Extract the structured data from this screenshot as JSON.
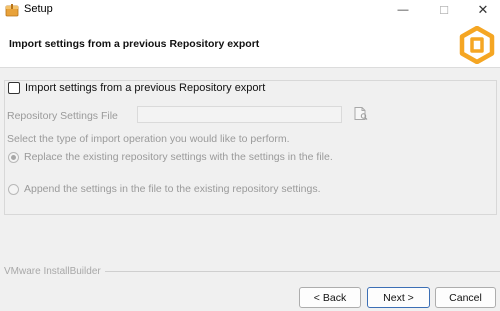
{
  "window": {
    "title": "Setup",
    "icon": "setup-app-icon",
    "controls": {
      "minimize": "—",
      "maximize": "☐",
      "close": "✕"
    }
  },
  "header": {
    "title": "Import settings from a previous Repository export",
    "logo_icon": "cube-logo-icon",
    "logo_color": "#f5a623"
  },
  "import_section": {
    "checkbox_label": "Import settings from a previous Repository export",
    "checkbox_checked": false,
    "file_label": "Repository Settings File",
    "file_value": "",
    "browse_icon": "browse-file-icon",
    "prompt": "Select the type of import operation you would like to perform.",
    "options": [
      {
        "label": "Replace the existing repository settings with the settings in the file.",
        "selected": true
      },
      {
        "label": "Append the settings in the file to the existing repository settings.",
        "selected": false
      }
    ]
  },
  "footer": {
    "brand": "VMware InstallBuilder",
    "back_label": "< Back",
    "next_label": "Next >",
    "cancel_label": "Cancel"
  },
  "colors": {
    "accent": "#3c6fb5",
    "disabled_text": "#9a9a9a",
    "logo": "#f5a623"
  }
}
